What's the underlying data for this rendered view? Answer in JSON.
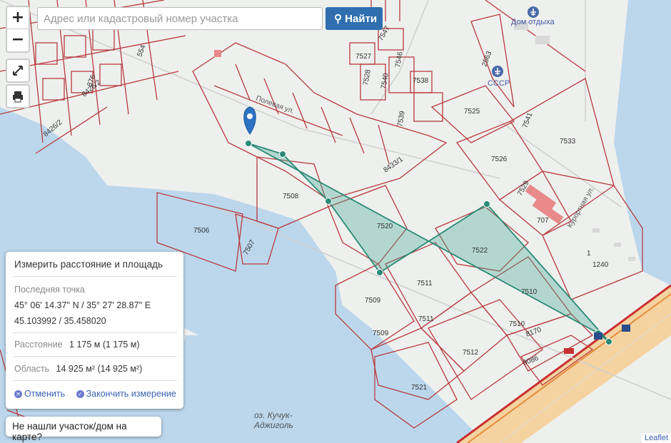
{
  "search": {
    "placeholder": "Адрес или кадастровый номер участка",
    "button_label": "Найти"
  },
  "zoom": {
    "in": "+",
    "out": "−"
  },
  "measure": {
    "title": "Измерить расстояние и площадь",
    "last_point_label": "Последняя точка",
    "dms": "45° 06' 14.37'' N / 35° 27' 28.87'' E",
    "decimal": "45.103992 / 35.458020",
    "distance_label": "Расстояние",
    "distance_value": "1 175 м (1 175 м)",
    "area_label": "Область",
    "area_value": "14 925 м² (14 925 м²)",
    "cancel": "Отменить",
    "finish": "Закончить измерение"
  },
  "not_found": "Не нашли участок/дом на карте?",
  "attribution": "Leaflet",
  "map": {
    "poi_rest": "Дом отдыха",
    "poi_ussr": "СССР",
    "lake": [
      "оз. Кучук-",
      "Аджиголь"
    ],
    "street_kurortnaya": "Курортная ул.",
    "street_poleva": "Полевая ул.",
    "parcels": [
      "7508",
      "7506",
      "7507",
      "7520",
      "7522",
      "7509",
      "7509",
      "7511",
      "7511",
      "7510",
      "7510",
      "7512",
      "7521",
      "8170",
      "8086",
      "7533",
      "7526",
      "7525",
      "7541",
      "7529",
      "707",
      "1240",
      "8433/1",
      "7527",
      "7547",
      "7528",
      "7540",
      "7546",
      "7538",
      "7539",
      "8426/2",
      "8426/2",
      "876",
      "554",
      "2563",
      "1"
    ]
  },
  "colors": {
    "parcel": "#b83a3e",
    "measure": "#2a8a76",
    "water": "#bcd7ec",
    "road": "#f5c98a"
  }
}
